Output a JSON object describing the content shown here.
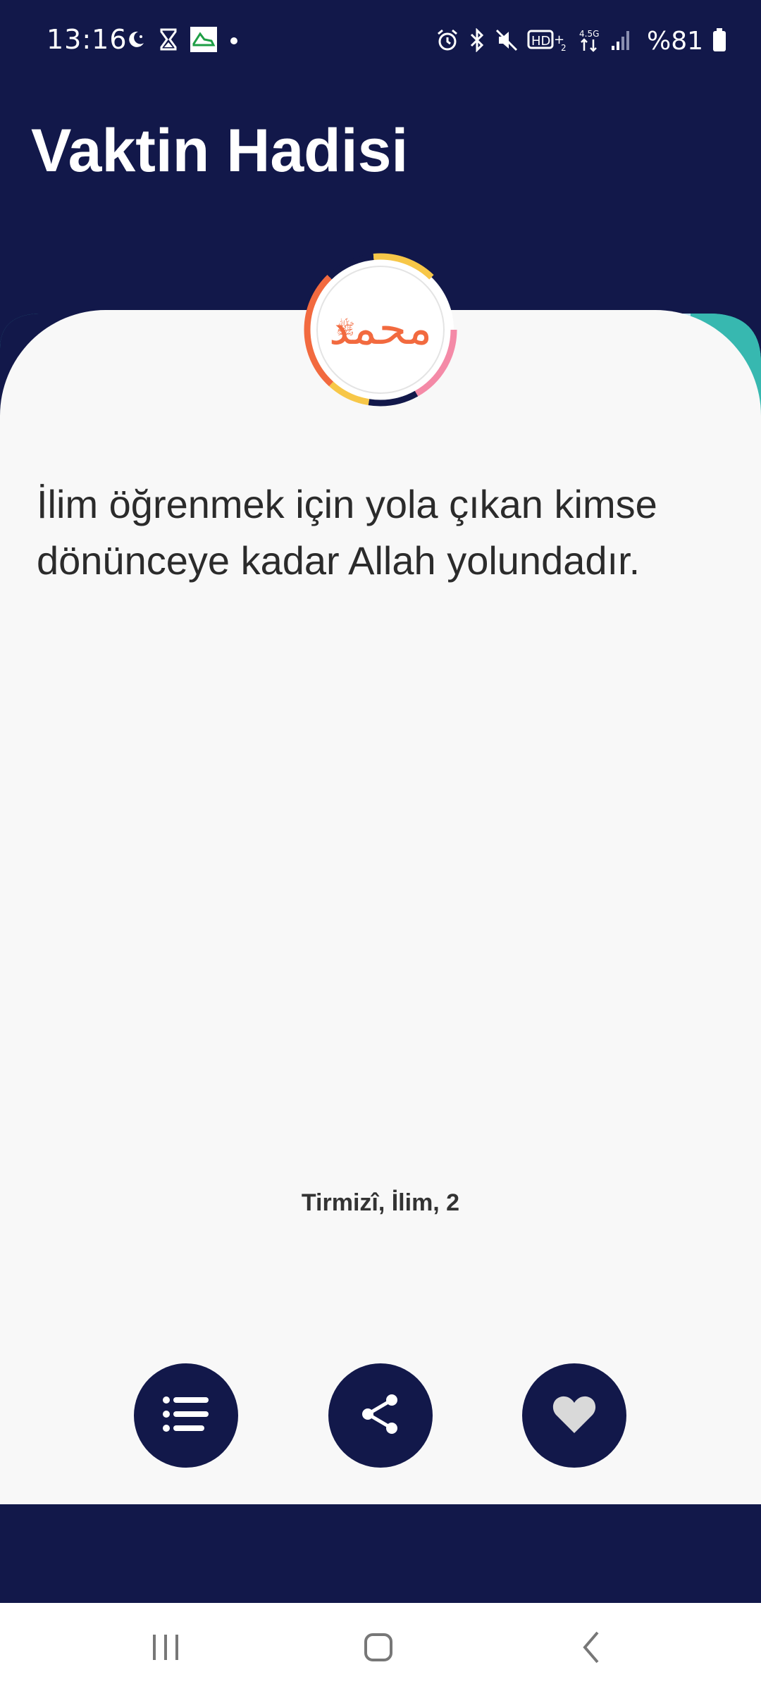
{
  "status_bar": {
    "time": "13:16",
    "battery": "%81",
    "left_icons": [
      "moon-icon",
      "hourglass-icon",
      "shoe-app-icon",
      "dot-icon"
    ],
    "right_icons": [
      "alarm-icon",
      "bluetooth-icon",
      "mute-icon",
      "hd-icon",
      "network-4-5g-icon",
      "signal-icon",
      "battery-icon"
    ]
  },
  "header": {
    "title": "Vaktin Hadisi"
  },
  "hadith": {
    "text": "İlim öğrenmek için yola çıkan kimse dönünceye kadar Allah yolundadır.",
    "source": "Tirmizî, İlim, 2"
  },
  "actions": [
    {
      "icon": "list-icon",
      "name": "list-button"
    },
    {
      "icon": "share-icon",
      "name": "share-button"
    },
    {
      "icon": "heart-icon",
      "name": "favorite-button"
    }
  ],
  "colors": {
    "navy": "#12184a",
    "card": "#f8f8f8",
    "accent_orange": "#f26a3f",
    "accent_teal": "#37b8b0",
    "accent_yellow": "#f7c748",
    "accent_pink": "#f48aa7"
  }
}
